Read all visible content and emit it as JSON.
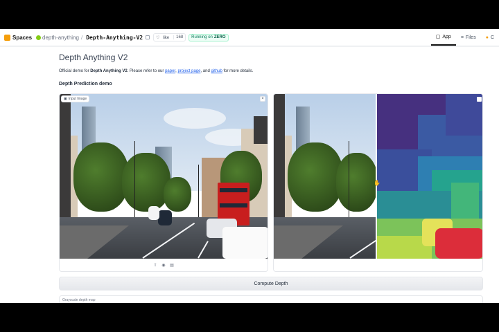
{
  "topbar": {
    "spaces_label": "Spaces",
    "owner": "depth-anything",
    "separator": "/",
    "repo": "Depth-Anything-V2",
    "like_label": "like",
    "like_count": "168",
    "status_prefix": "Running on",
    "status_hw": "ZERO",
    "tabs": [
      {
        "label": "App",
        "icon": "app-icon",
        "active": true
      },
      {
        "label": "Files",
        "icon": "files-icon",
        "active": false
      },
      {
        "label": "C",
        "icon": "community-icon",
        "active": false
      }
    ]
  },
  "main": {
    "title": "Depth Anything V2",
    "description": {
      "prefix": "Official demo for ",
      "model": "Depth Anything V2",
      "mid": ". Please refer to our ",
      "link_paper": "paper",
      "comma": ", ",
      "link_project": "project page",
      "and": ", and ",
      "link_github": "github",
      "suffix": " for more details."
    },
    "section_title": "Depth Prediction demo",
    "input_label": "Input Image",
    "compute_button": "Compute Depth",
    "grayscale_label": "Grayscale depth map"
  },
  "icons": {
    "close": "×",
    "upload": "⇪",
    "webcam": "◉",
    "clipboard": "▤",
    "handle": "✋"
  },
  "colors": {
    "accent": "#111111",
    "link": "#2563eb",
    "status_bg": "#ecfdf5",
    "status_text": "#047857"
  }
}
